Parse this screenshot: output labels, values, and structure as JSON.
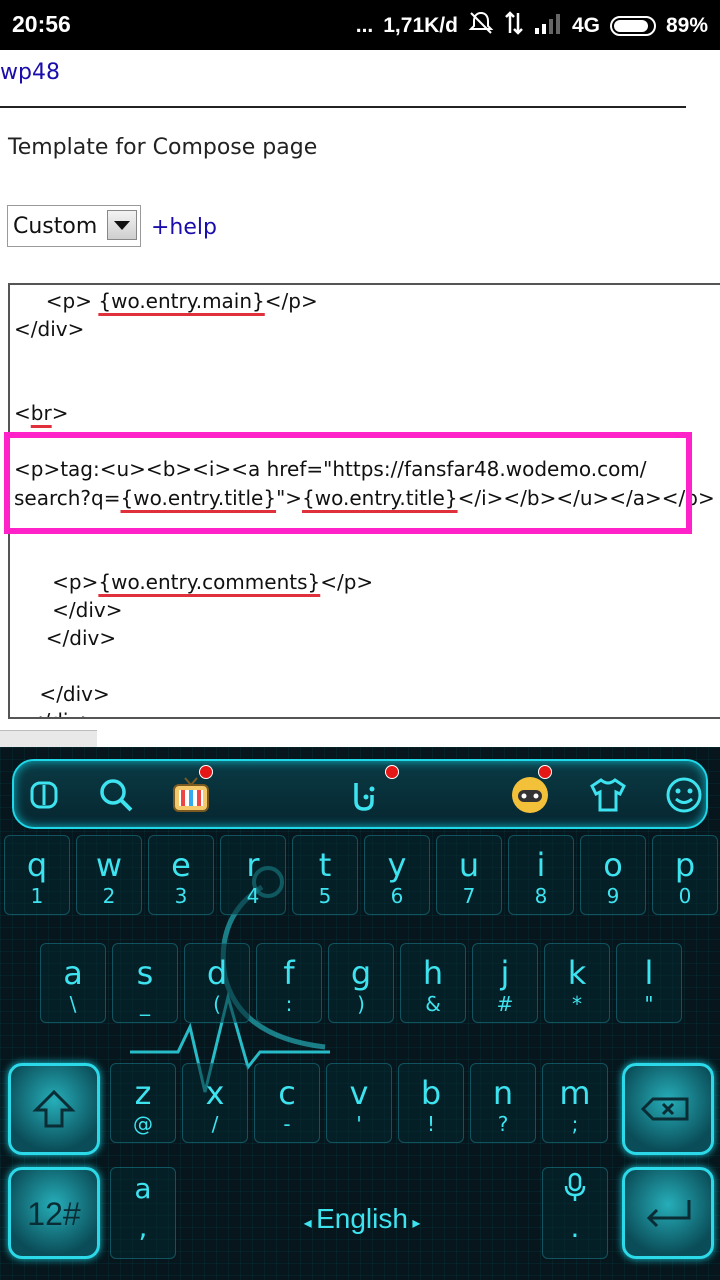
{
  "status_bar": {
    "time": "20:56",
    "dots": "...",
    "net_speed": "1,71K/d",
    "network_type": "4G",
    "battery": "89%",
    "battery_level": 0.89,
    "icons": [
      "mute-icon",
      "data-arrows-icon",
      "signal-icon",
      "battery-icon"
    ]
  },
  "page": {
    "top_link": "wp48",
    "template_label": "Template for  Compose  page",
    "select_value": "Custom",
    "help_link": "+help"
  },
  "editor": {
    "line1_pre": "     <p> ",
    "line1_token": "{wo.entry.main}",
    "line1_post": "</p>",
    "line2": "</div>",
    "line3_pre": "<",
    "line3_token": "br",
    "line3_post": ">",
    "line4": "<p>tag:<u><b><i><a href=\"https://fansfar48.wodemo.com/",
    "line5_pre": "search?q=",
    "line5_token1": "{wo.entry.title}",
    "line5_mid": "\">",
    "line5_token2": "{wo.entry.title}",
    "line5_post": "</i></b></u></a></p>",
    "line6_pre": "      <p>",
    "line6_token": "{wo.entry.comments}",
    "line6_post": "</p>",
    "line7": "      </div>",
    "line8": "     </div>",
    "line9": "    </div>",
    "line10": "  </div>"
  },
  "keyboard": {
    "toolbar_icons": [
      "cursor-icon",
      "search-icon",
      "tv-theme-icon",
      "gesture-icon",
      "game-icon",
      "shirt-icon",
      "emoji-icon"
    ],
    "row1": [
      {
        "main": "q",
        "sub": "1"
      },
      {
        "main": "w",
        "sub": "2"
      },
      {
        "main": "e",
        "sub": "3"
      },
      {
        "main": "r",
        "sub": "4"
      },
      {
        "main": "t",
        "sub": "5"
      },
      {
        "main": "y",
        "sub": "6"
      },
      {
        "main": "u",
        "sub": "7"
      },
      {
        "main": "i",
        "sub": "8"
      },
      {
        "main": "o",
        "sub": "9"
      },
      {
        "main": "p",
        "sub": "0"
      }
    ],
    "row2": [
      {
        "main": "a",
        "sub": "\\"
      },
      {
        "main": "s",
        "sub": "_"
      },
      {
        "main": "d",
        "sub": "("
      },
      {
        "main": "f",
        "sub": ":"
      },
      {
        "main": "g",
        "sub": ")"
      },
      {
        "main": "h",
        "sub": "&"
      },
      {
        "main": "j",
        "sub": "#"
      },
      {
        "main": "k",
        "sub": "*"
      },
      {
        "main": "l",
        "sub": "\""
      }
    ],
    "row3": [
      {
        "main": "z",
        "sub": "@"
      },
      {
        "main": "x",
        "sub": "/"
      },
      {
        "main": "c",
        "sub": "-"
      },
      {
        "main": "v",
        "sub": "'"
      },
      {
        "main": "b",
        "sub": "!"
      },
      {
        "main": "n",
        "sub": "?"
      },
      {
        "main": "m",
        "sub": ";"
      }
    ],
    "symbols_key": "12#",
    "comma_key_top": "a",
    "comma_key": ",",
    "language": "English",
    "period_key": "."
  }
}
